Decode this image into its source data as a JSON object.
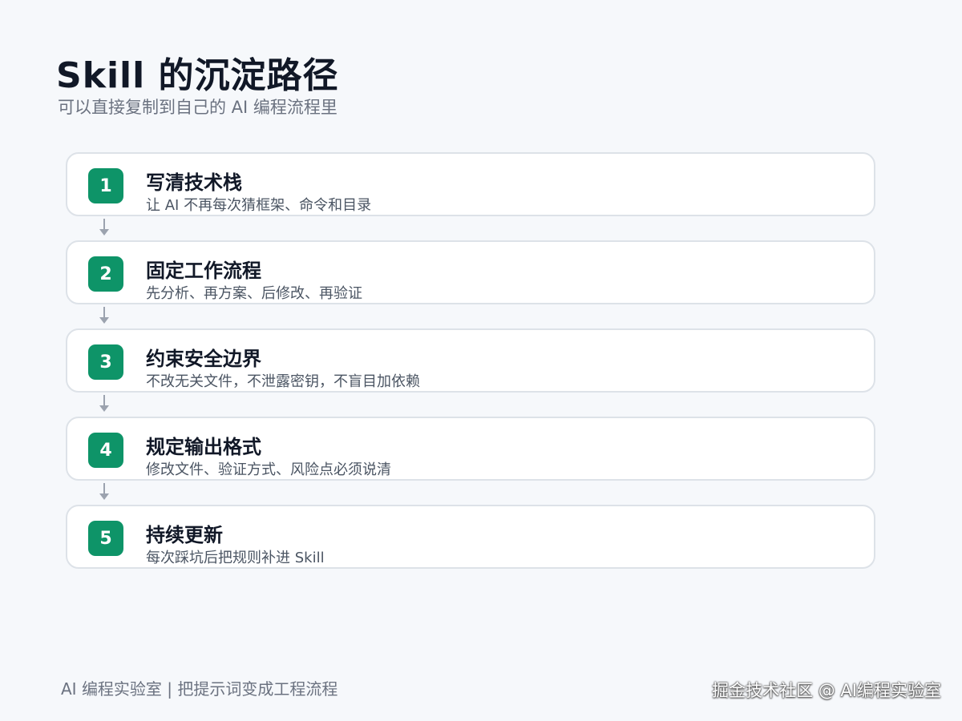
{
  "header": {
    "title": "Skill 的沉淀路径",
    "subtitle": "可以直接复制到自己的 AI 编程流程里"
  },
  "steps": [
    {
      "number": "1",
      "title": "写清技术栈",
      "description": "让 AI 不再每次猜框架、命令和目录"
    },
    {
      "number": "2",
      "title": "固定工作流程",
      "description": "先分析、再方案、后修改、再验证"
    },
    {
      "number": "3",
      "title": "约束安全边界",
      "description": "不改无关文件，不泄露密钥，不盲目加依赖"
    },
    {
      "number": "4",
      "title": "规定输出格式",
      "description": "修改文件、验证方式、风险点必须说清"
    },
    {
      "number": "5",
      "title": "持续更新",
      "description": "每次踩坑后把规则补进 Skill"
    }
  ],
  "footer": {
    "left": "AI 编程实验室 | 把提示词变成工程流程",
    "watermark": "掘金技术社区 @ AI编程实验室"
  },
  "colors": {
    "accent": "#0e9468",
    "arrow": "#9ca3af",
    "card_border": "#dde2e8"
  }
}
